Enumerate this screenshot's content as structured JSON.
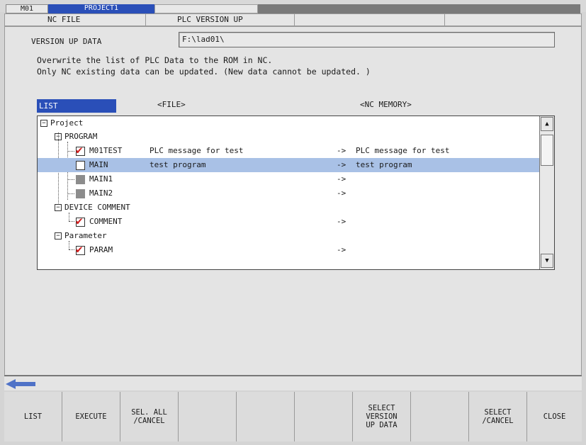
{
  "top": {
    "machine": "M01",
    "project": "PROJECT1"
  },
  "menu": {
    "nc_file": "NC FILE",
    "plc_version_up": "PLC VERSION UP"
  },
  "version_up": {
    "label": "VERSION UP DATA",
    "value": "F:\\lad01\\"
  },
  "messages": [
    "Overwrite the list of PLC Data to the ROM in NC.",
    "Only NC existing data can be updated. (New data cannot be updated. )"
  ],
  "columns": {
    "list": "LIST",
    "file": "<FILE>",
    "nc_memory": "<NC MEMORY>"
  },
  "tree": {
    "project": "Project",
    "program": "PROGRAM",
    "m01test": {
      "name": "M01TEST",
      "file": "PLC message for test",
      "arrow": "->",
      "nc": "PLC message for test",
      "state": "checked"
    },
    "main": {
      "name": "MAIN",
      "file": "test program",
      "arrow": "->",
      "nc": "test program",
      "state": "unchecked"
    },
    "main1": {
      "name": "MAIN1",
      "arrow": "->",
      "state": "disabled"
    },
    "main2": {
      "name": "MAIN2",
      "arrow": "->",
      "state": "disabled"
    },
    "device_comment": "DEVICE COMMENT",
    "comment": {
      "name": "COMMENT",
      "arrow": "->",
      "state": "checked"
    },
    "parameter": "Parameter",
    "param": {
      "name": "PARAM",
      "arrow": "->",
      "state": "checked"
    }
  },
  "fkeys": [
    "LIST",
    "EXECUTE",
    "SEL. ALL\n/CANCEL",
    "",
    "",
    "",
    "SELECT\nVERSION\nUP DATA",
    "",
    "SELECT\n/CANCEL",
    "CLOSE"
  ],
  "colors": {
    "accent": "#2a4fb8",
    "selection": "#a9c1e6",
    "check": "#d21b1b",
    "arrow": "#4f72c7"
  }
}
